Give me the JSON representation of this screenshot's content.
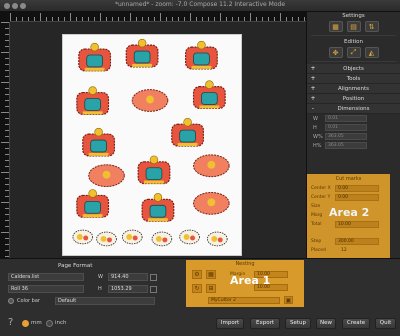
{
  "window": {
    "title": "*unnamed* - zoom: -7.0 Compose 11.2 Interactive Mode"
  },
  "settings": {
    "title": "Settings"
  },
  "edition": {
    "title": "Edition"
  },
  "sections": [
    {
      "sign": "+",
      "label": "Objects"
    },
    {
      "sign": "+",
      "label": "Tools"
    },
    {
      "sign": "+",
      "label": "Alignments"
    },
    {
      "sign": "+",
      "label": "Position"
    },
    {
      "sign": "-",
      "label": "Dimensions"
    }
  ],
  "dimensions": [
    {
      "key": "W",
      "value": "0.01"
    },
    {
      "key": "H",
      "value": "0.01"
    },
    {
      "key": "W%",
      "value": "363.05"
    },
    {
      "key": "H%",
      "value": "363.05"
    }
  ],
  "cut_marks": {
    "title": "Cut marks",
    "rows": [
      {
        "key": "Center X",
        "value": "0.00"
      },
      {
        "key": "Center Y",
        "value": "0.00"
      },
      {
        "key": "Size",
        "value": ""
      },
      {
        "key": "Marg",
        "value": ""
      },
      {
        "key": "Total",
        "value": "10.00"
      }
    ],
    "step_key": "Step",
    "step_value": "300.00",
    "placed_key": "Placed",
    "placed_value": "12",
    "area_label": "Area 2"
  },
  "page_format": {
    "title": "Page Format",
    "printer": "Caldera.list",
    "roll": "Roll 36",
    "w_label": "W",
    "w_value": "914.40",
    "h_label": "H",
    "h_value": "1053.29",
    "color_bar_label": "Color bar",
    "color_bar_value": "Default"
  },
  "nesting": {
    "title": "Nesting",
    "margin_label": "Margin",
    "margin_value": "10.00",
    "value2": "10.00",
    "cutter": "MyCutter 2",
    "area_label": "Area 1"
  },
  "units": {
    "mm": "mm",
    "inch": "inch",
    "selected": "mm"
  },
  "help_label": "?",
  "actions": [
    "Import",
    "Export",
    "Setup",
    "New",
    "Create",
    "Quit"
  ],
  "colors": {
    "accent": "#d89a2a",
    "sticker_red": "#e8553f",
    "sticker_teal": "#2aa3a8"
  }
}
